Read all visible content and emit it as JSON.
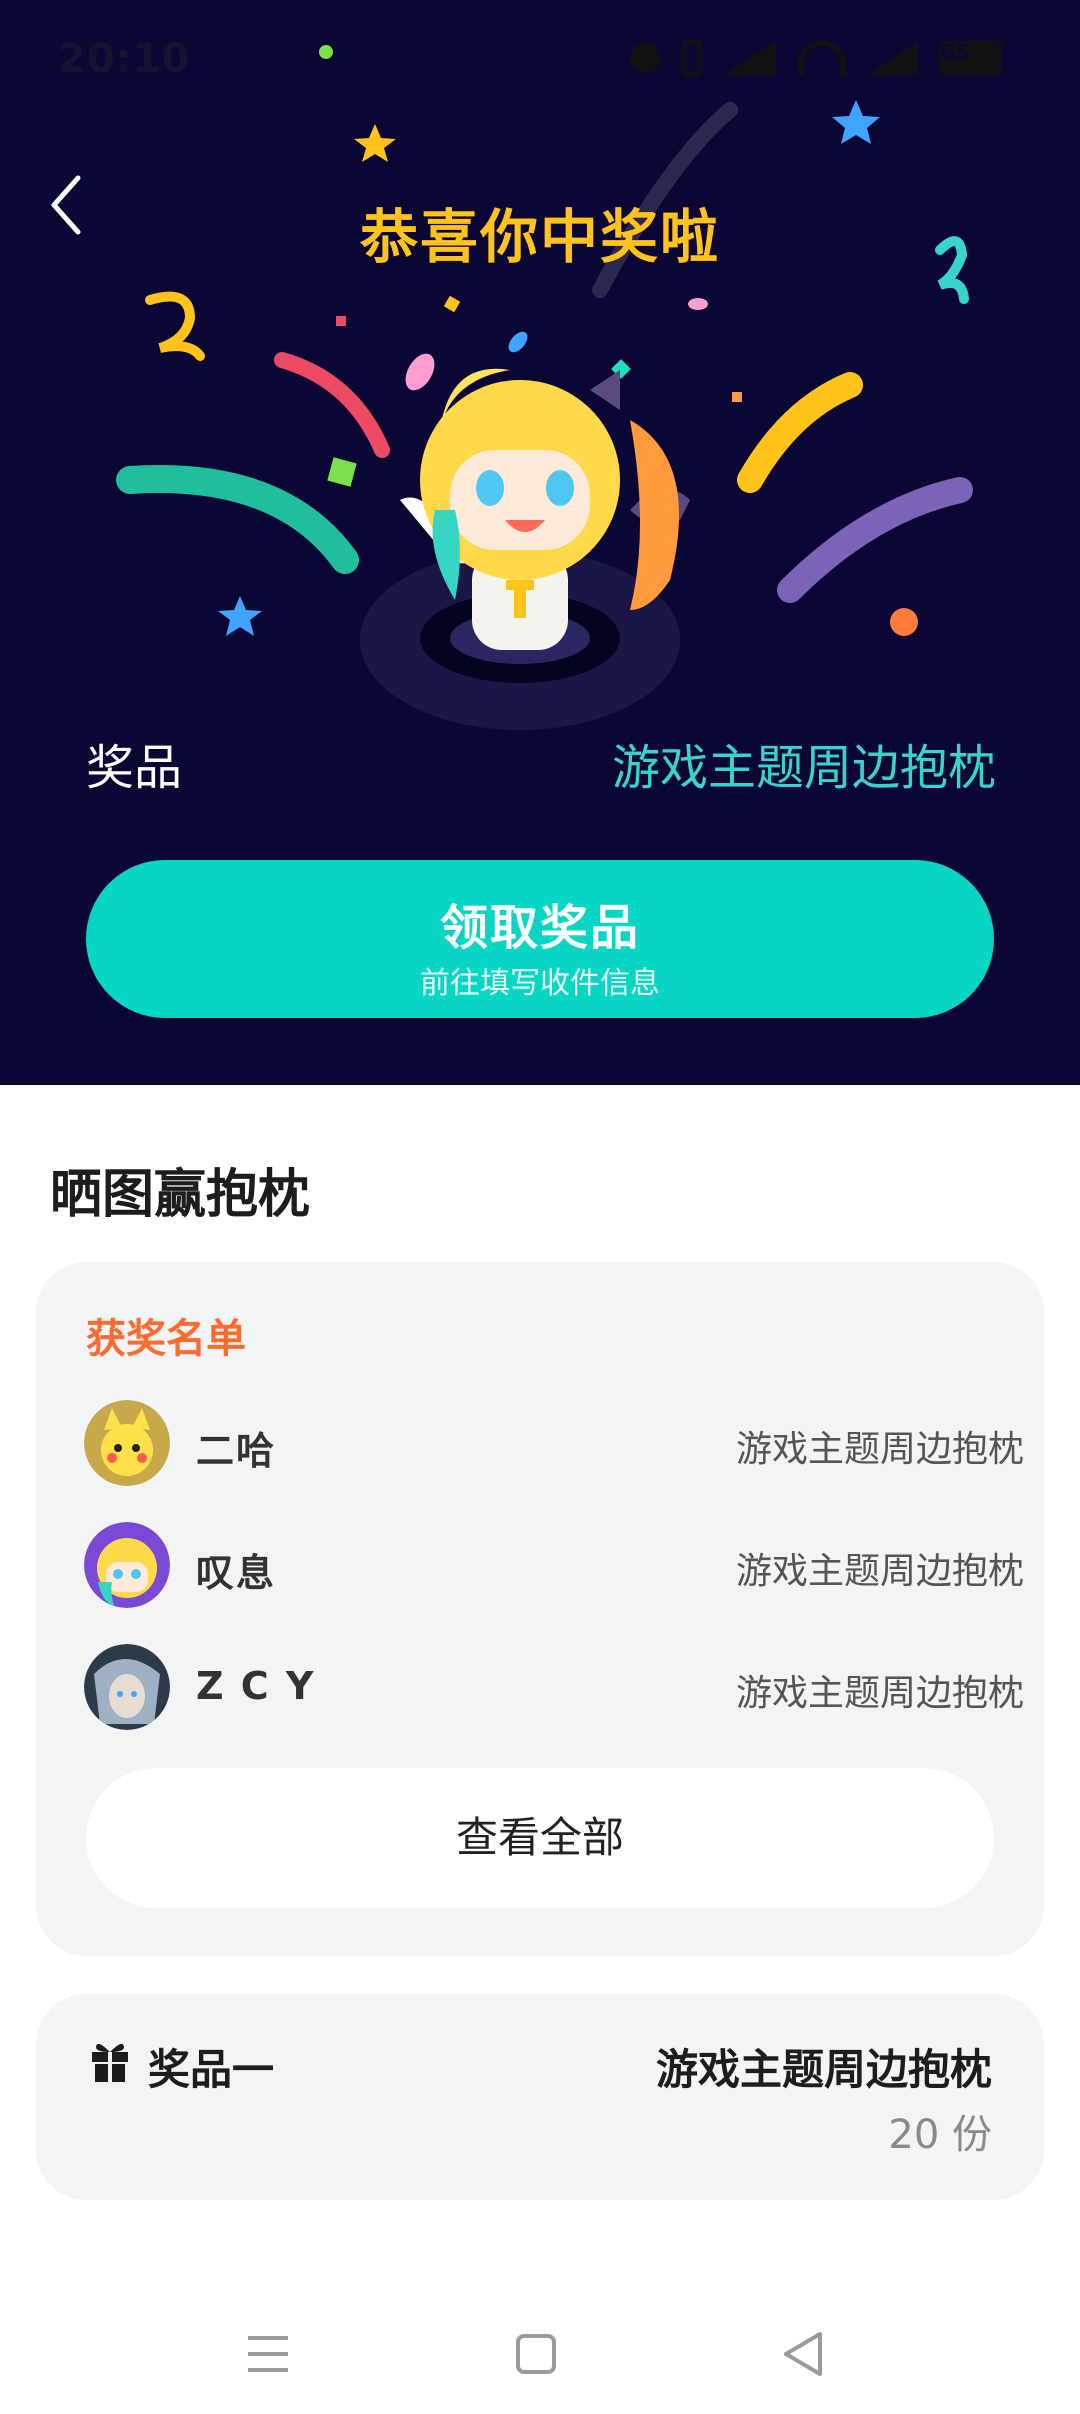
{
  "status_bar": {
    "time": "20:10",
    "battery": "65"
  },
  "hero": {
    "title": "恭喜你中奖啦",
    "prize_label": "奖品",
    "prize_value": "游戏主题周边抱枕",
    "claim_button_title": "领取奖品",
    "claim_button_subtitle": "前往填写收件信息"
  },
  "share_section": {
    "title": "晒图赢抱枕",
    "winners_title": "获奖名单",
    "winners": [
      {
        "name": "二哈",
        "prize": "游戏主题周边抱枕"
      },
      {
        "name": "叹息",
        "prize": "游戏主题周边抱枕"
      },
      {
        "name": "Z C Y",
        "prize": "游戏主题周边抱枕"
      }
    ],
    "view_all": "查看全部"
  },
  "prize_card": {
    "label": "奖品一",
    "name": "游戏主题周边抱枕",
    "count": "20 份"
  },
  "colors": {
    "hero_bg": "#0a0734",
    "title_yellow": "#ffc31a",
    "accent_teal": "#07d6c4",
    "prize_teal": "#39d3cf",
    "winners_orange": "#ff6a2f",
    "card_bg": "#f3f4f6"
  },
  "icons": {
    "back": "chevron-left-icon",
    "gift": "gift-icon",
    "nav_menu": "menu-icon",
    "nav_home": "square-home-icon",
    "nav_back": "triangle-back-icon"
  }
}
